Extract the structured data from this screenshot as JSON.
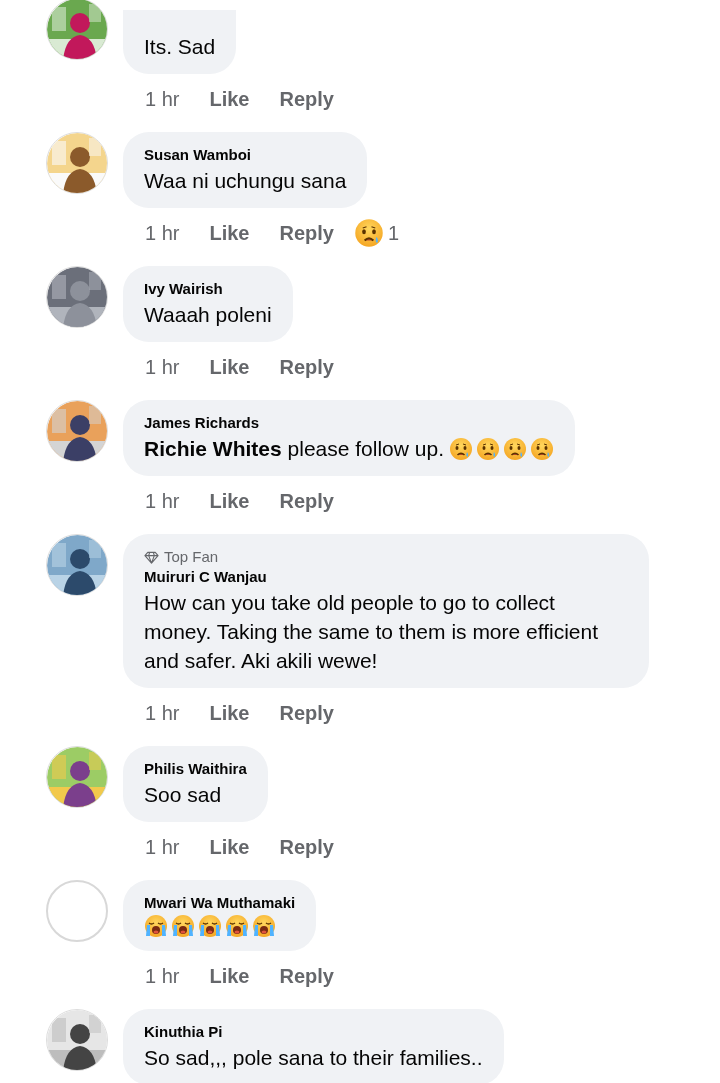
{
  "comments": [
    {
      "avatar": {
        "kind": "picture"
      },
      "text": "Its. Sad",
      "time": "1 hr",
      "like": "Like",
      "reply": "Reply"
    },
    {
      "avatar": {
        "kind": "picture"
      },
      "name": "Susan Wamboi",
      "text": "Waa ni uchungu sana",
      "time": "1 hr",
      "like": "Like",
      "reply": "Reply",
      "reaction": {
        "kind": "sad",
        "count": "1"
      }
    },
    {
      "avatar": {
        "kind": "picture"
      },
      "name": "Ivy Wairish",
      "text": "Waaah poleni",
      "time": "1 hr",
      "like": "Like",
      "reply": "Reply"
    },
    {
      "avatar": {
        "kind": "picture"
      },
      "name": "James Richards",
      "text": "**Richie Whites** please follow up.",
      "emojis": [
        {
          "kind": "sad-tear"
        },
        {
          "kind": "sad-tear"
        },
        {
          "kind": "sad-tear"
        },
        {
          "kind": "sad-tear"
        }
      ],
      "time": "1 hr",
      "like": "Like",
      "reply": "Reply"
    },
    {
      "avatar": {
        "kind": "picture"
      },
      "badge": "Top Fan",
      "name": "Muiruri C Wanjau",
      "text": "How can you take old people to go to collect money. Taking the same to them is more efficient and safer. Aki akili wewe!",
      "time": "1 hr",
      "like": "Like",
      "reply": "Reply"
    },
    {
      "avatar": {
        "kind": "picture"
      },
      "name": "Philis Waithira",
      "text": "Soo sad",
      "time": "1 hr",
      "like": "Like",
      "reply": "Reply"
    },
    {
      "avatar": {
        "kind": "blank"
      },
      "name": "Mwari Wa Muthamaki",
      "emojis": [
        {
          "kind": "loud-cry"
        },
        {
          "kind": "loud-cry"
        },
        {
          "kind": "loud-cry"
        },
        {
          "kind": "loud-cry"
        },
        {
          "kind": "loud-cry"
        }
      ],
      "time": "1 hr",
      "like": "Like",
      "reply": "Reply"
    },
    {
      "avatar": {
        "kind": "picture"
      },
      "name": "Kinuthia Pi",
      "text": "So sad,,, pole sana to their families.."
    }
  ]
}
